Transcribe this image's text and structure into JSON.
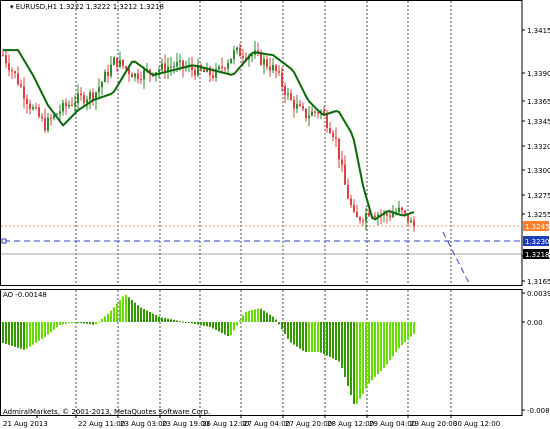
{
  "header": {
    "symbol": "EURUSD,H1",
    "ohlc": "1.3222 1.3222 1.3212 1.3218"
  },
  "indicator": {
    "label": "AO -0.00148",
    "ticks": [
      "0.00391",
      "0.00",
      "-0.00803"
    ]
  },
  "price_axis": {
    "ticks": [
      "1.3415",
      "1.3390",
      "1.3365",
      "1.3345",
      "1.3320",
      "1.3300",
      "1.3275",
      "1.3255",
      "1.3190",
      "1.3165"
    ],
    "tags": [
      {
        "text": "1.3245",
        "bg": "#ff7f2a",
        "fg": "#ffffff"
      },
      {
        "text": "1.3230",
        "bg": "#1f3fbf",
        "fg": "#ffffff"
      },
      {
        "text": "1.3218",
        "bg": "#000000",
        "fg": "#ffffff"
      }
    ]
  },
  "time_axis": {
    "labels": [
      "21 Aug 2013",
      "22 Aug 11:00",
      "23 Aug 03:00",
      "23 Aug 19:00",
      "26 Aug 12:00",
      "27 Aug 04:00",
      "27 Aug 20:00",
      "28 Aug 12:00",
      "29 Aug 04:00",
      "29 Aug 20:00",
      "30 Aug 12:00"
    ]
  },
  "copyright": "AdmiralMarkets, © 2001-2013, MetaQuotes Software Corp.",
  "colors": {
    "bull": "#2e8b2e",
    "bear": "#e04040",
    "ma": "#0a6a0a",
    "ao_up": "#66dd00",
    "ao_down": "#339900",
    "level_orange": "#ff9966",
    "level_blue": "#3344cc"
  }
}
